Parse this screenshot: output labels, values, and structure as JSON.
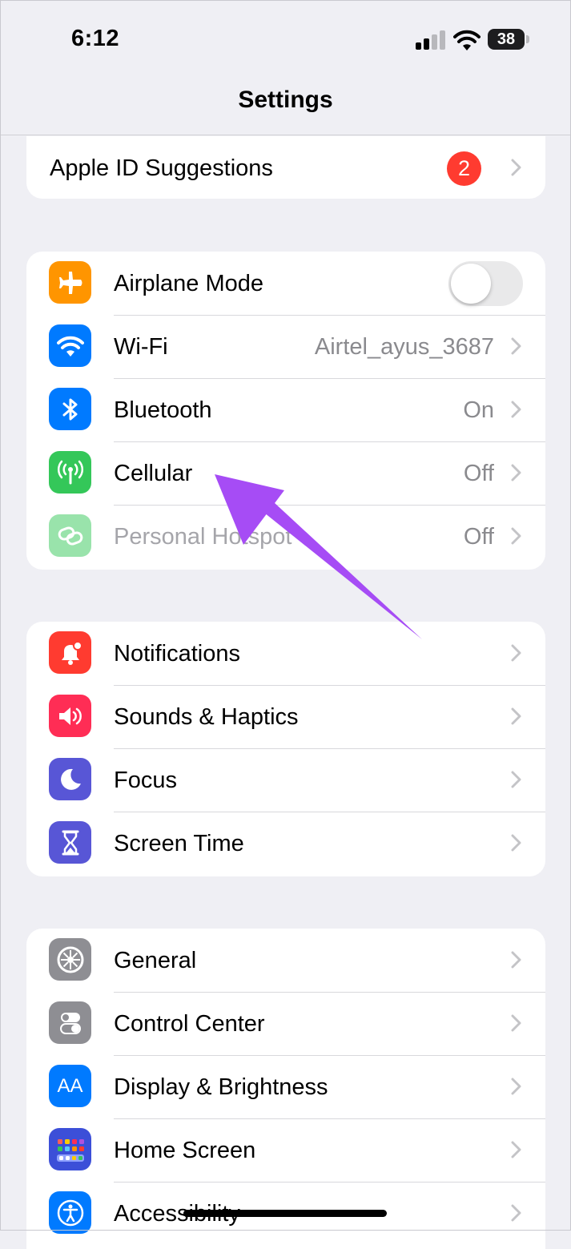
{
  "status_bar": {
    "time": "6:12",
    "battery": "38"
  },
  "nav": {
    "title": "Settings"
  },
  "groups": {
    "suggestions": {
      "apple_id": {
        "label": "Apple ID Suggestions",
        "badge": "2"
      }
    },
    "connectivity": [
      {
        "label": "Airplane Mode",
        "icon": "airplane-icon",
        "color": "#ff9500",
        "toggle_on": false
      },
      {
        "label": "Wi-Fi",
        "value": "Airtel_ayus_3687",
        "icon": "wifi-icon",
        "color": "#007aff"
      },
      {
        "label": "Bluetooth",
        "value": "On",
        "icon": "bluetooth-icon",
        "color": "#007aff"
      },
      {
        "label": "Cellular",
        "value": "Off",
        "icon": "antenna-icon",
        "color": "#34c759"
      },
      {
        "label": "Personal Hotspot",
        "value": "Off",
        "icon": "hotspot-link-icon",
        "color": "#34c759",
        "disabled": true
      }
    ],
    "notifications": [
      {
        "label": "Notifications",
        "icon": "bell-icon",
        "color": "#ff3b30"
      },
      {
        "label": "Sounds & Haptics",
        "icon": "speaker-icon",
        "color": "#ff2d55"
      },
      {
        "label": "Focus",
        "icon": "moon-icon",
        "color": "#5856d6"
      },
      {
        "label": "Screen Time",
        "icon": "hourglass-icon",
        "color": "#5856d6"
      }
    ],
    "general": [
      {
        "label": "General",
        "icon": "gear-icon",
        "color": "#8e8e93"
      },
      {
        "label": "Control Center",
        "icon": "switches-icon",
        "color": "#8e8e93"
      },
      {
        "label": "Display & Brightness",
        "icon": "text-size-icon",
        "icon_text": "AA",
        "color": "#007aff"
      },
      {
        "label": "Home Screen",
        "icon": "app-grid-icon",
        "color": "#3c4fd8"
      },
      {
        "label": "Accessibility",
        "icon": "accessibility-icon",
        "color": "#007aff"
      }
    ]
  },
  "annotation": {
    "color": "#a64cf5"
  }
}
